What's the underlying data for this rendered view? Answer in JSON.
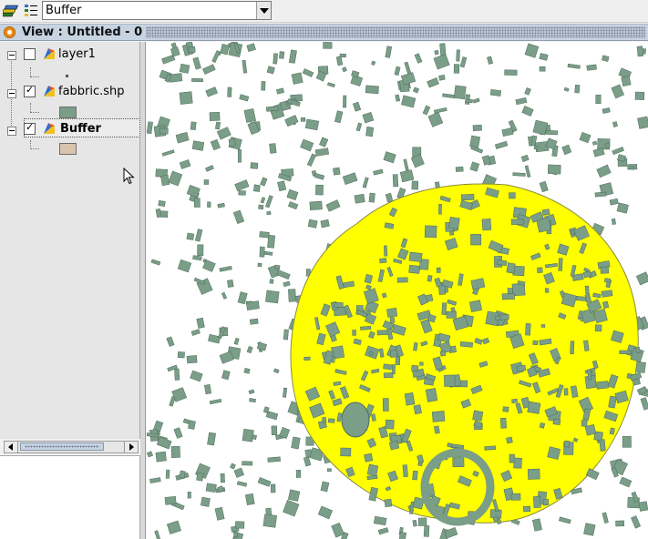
{
  "toolbar": {
    "layer_manager_icon": "layers-stack-icon",
    "legend_icon": "legend-list-icon",
    "active_layer_combo": {
      "value": "Buffer"
    }
  },
  "view": {
    "title": "View : Untitled - 0",
    "icon": "view-globe-icon"
  },
  "toc": {
    "layers": [
      {
        "label": "layer1",
        "checked": false,
        "bold": false,
        "legend_color": ""
      },
      {
        "label": "fabbric.shp",
        "checked": true,
        "bold": false,
        "legend_color": "#7a9e88"
      },
      {
        "label": "Buffer",
        "checked": true,
        "bold": true,
        "legend_color": "#d8c3ae"
      }
    ]
  },
  "map": {
    "background": "#ffffff",
    "building_fill": "#7a9e88",
    "building_stroke": "#4e6b5a",
    "buffer_fill": "#ffff00",
    "buffer_stroke": "#8a8a40"
  }
}
